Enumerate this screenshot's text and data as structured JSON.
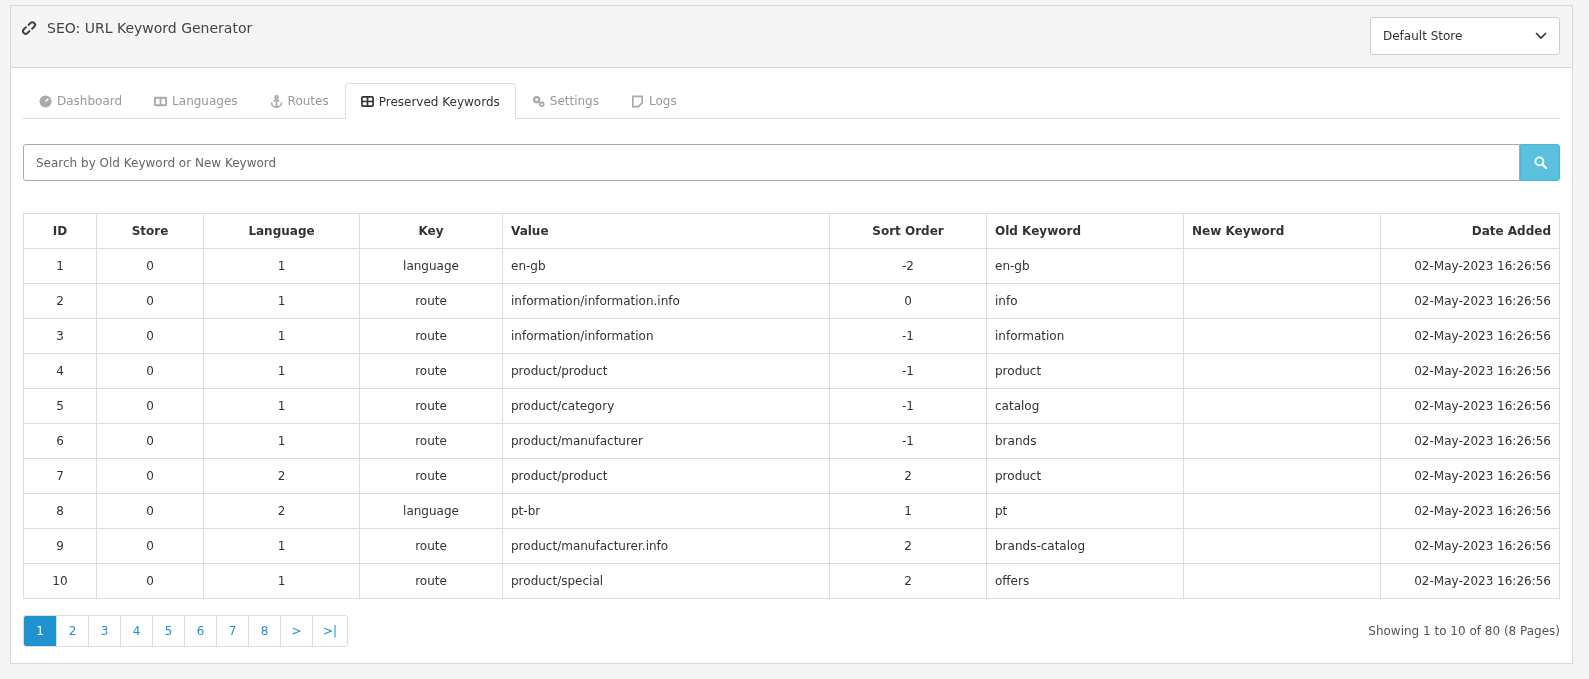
{
  "header": {
    "title": "SEO: URL Keyword Generator",
    "store_select": {
      "value": "Default Store"
    }
  },
  "tabs": [
    {
      "label": "Dashboard",
      "selected": false
    },
    {
      "label": "Languages",
      "selected": false
    },
    {
      "label": "Routes",
      "selected": false
    },
    {
      "label": "Preserved Keywords",
      "selected": true
    },
    {
      "label": "Settings",
      "selected": false
    },
    {
      "label": "Logs",
      "selected": false
    }
  ],
  "search": {
    "placeholder": "Search by Old Keyword or New Keyword"
  },
  "table": {
    "columns": [
      "ID",
      "Store",
      "Language",
      "Key",
      "Value",
      "Sort Order",
      "Old Keyword",
      "New Keyword",
      "Date Added"
    ],
    "rows": [
      [
        "1",
        "0",
        "1",
        "language",
        "en-gb",
        "-2",
        "en-gb",
        "",
        "02-May-2023 16:26:56"
      ],
      [
        "2",
        "0",
        "1",
        "route",
        "information/information.info",
        "0",
        "info",
        "",
        "02-May-2023 16:26:56"
      ],
      [
        "3",
        "0",
        "1",
        "route",
        "information/information",
        "-1",
        "information",
        "",
        "02-May-2023 16:26:56"
      ],
      [
        "4",
        "0",
        "1",
        "route",
        "product/product",
        "-1",
        "product",
        "",
        "02-May-2023 16:26:56"
      ],
      [
        "5",
        "0",
        "1",
        "route",
        "product/category",
        "-1",
        "catalog",
        "",
        "02-May-2023 16:26:56"
      ],
      [
        "6",
        "0",
        "1",
        "route",
        "product/manufacturer",
        "-1",
        "brands",
        "",
        "02-May-2023 16:26:56"
      ],
      [
        "7",
        "0",
        "2",
        "route",
        "product/product",
        "2",
        "product",
        "",
        "02-May-2023 16:26:56"
      ],
      [
        "8",
        "0",
        "2",
        "language",
        "pt-br",
        "1",
        "pt",
        "",
        "02-May-2023 16:26:56"
      ],
      [
        "9",
        "0",
        "1",
        "route",
        "product/manufacturer.info",
        "2",
        "brands-catalog",
        "",
        "02-May-2023 16:26:56"
      ],
      [
        "10",
        "0",
        "1",
        "route",
        "product/special",
        "2",
        "offers",
        "",
        "02-May-2023 16:26:56"
      ]
    ]
  },
  "pagination": {
    "pages": [
      {
        "label": "1",
        "selected": true
      },
      {
        "label": "2",
        "selected": false
      },
      {
        "label": "3",
        "selected": false
      },
      {
        "label": "4",
        "selected": false
      },
      {
        "label": "5",
        "selected": false
      },
      {
        "label": "6",
        "selected": false
      },
      {
        "label": "7",
        "selected": false
      },
      {
        "label": "8",
        "selected": false
      },
      {
        "label": ">",
        "selected": false
      },
      {
        "label": ">|",
        "selected": false
      }
    ],
    "summary": "Showing 1 to 10 of 80 (8 Pages)"
  }
}
